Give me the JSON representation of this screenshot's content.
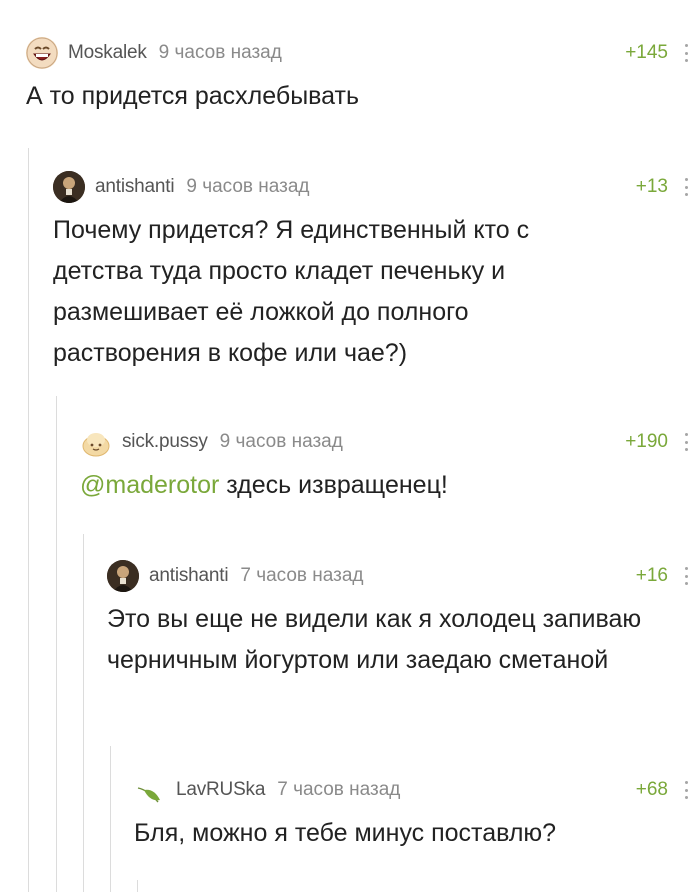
{
  "comments": [
    {
      "username": "Moskalek",
      "time": "9 часов назад",
      "rating": "+145",
      "body": "А то придется расхлебывать",
      "avatar_icon": "laughing-face-icon"
    },
    {
      "username": "antishanti",
      "time": "9 часов назад",
      "rating": "+13",
      "body": "Почему придется? Я единственный кто с детства туда просто кладет печеньку и размешивает её ложкой до полного растворения в кофе или чае?)",
      "avatar_icon": "portrait-photo-icon"
    },
    {
      "username": "sick.pussy",
      "time": "9 часов назад",
      "rating": "+190",
      "mention": "@maderotor",
      "body": " здесь извращенец!",
      "avatar_icon": "bun-avatar-icon"
    },
    {
      "username": "antishanti",
      "time": "7 часов назад",
      "rating": "+16",
      "body": "Это вы еще не видели как я холодец запиваю черничным йогуртом или заедаю сметаной",
      "avatar_icon": "portrait-photo-icon"
    },
    {
      "username": "LavRUSka",
      "time": "7 часов назад",
      "rating": "+68",
      "body": "Бля, можно я тебе минус поставлю?",
      "avatar_icon": "leaf-icon"
    }
  ],
  "colors": {
    "rating": "#7aa83a",
    "mention": "#7aa83a",
    "thread_line": "#dcdcdc"
  }
}
